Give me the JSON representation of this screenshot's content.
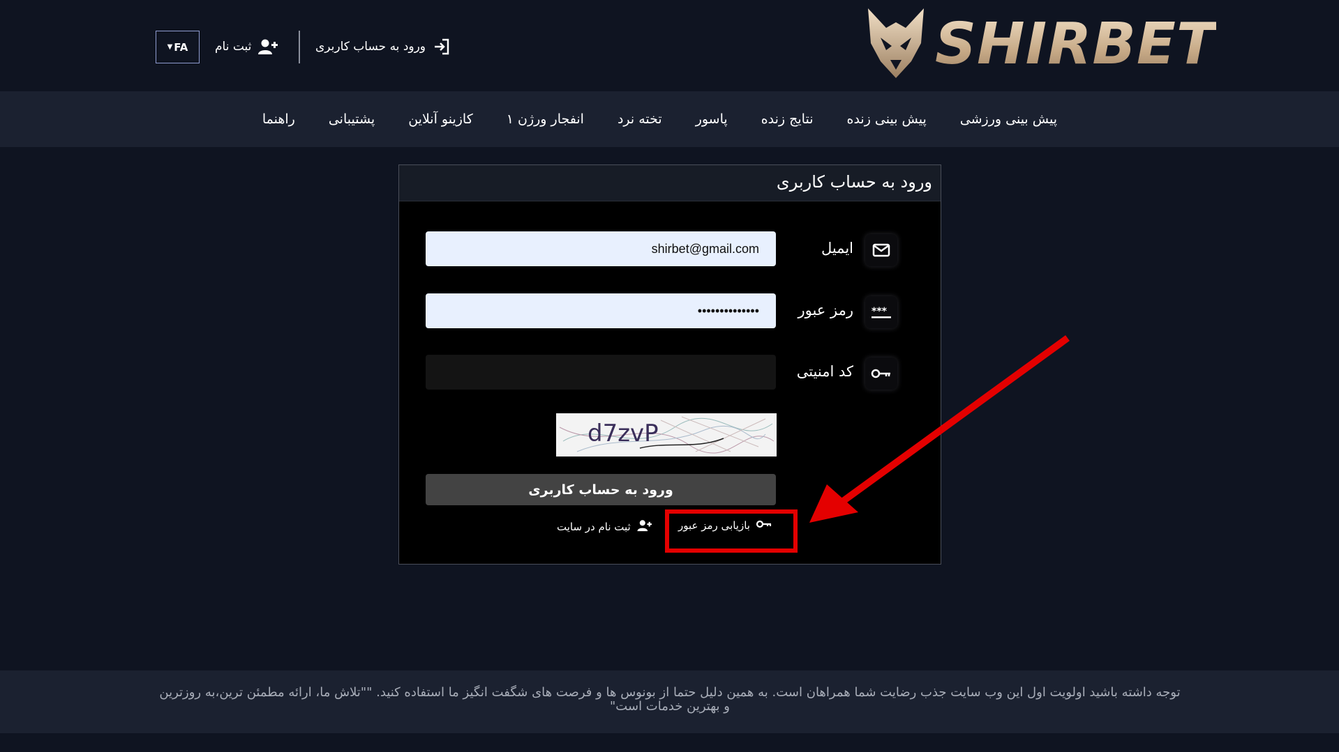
{
  "header": {
    "logo_text": "SHIRBET",
    "lang": "FA",
    "register_label": "ثبت نام",
    "login_label": "ورود به حساب کاربری"
  },
  "nav": {
    "items": [
      "پیش بینی ورزشی",
      "پیش بینی زنده",
      "نتایج زنده",
      "پاسور",
      "تخته نرد",
      "انفجار ورژن ۱",
      "کازینو آنلاین",
      "پشتیبانی",
      "راهنما"
    ]
  },
  "login_form": {
    "title": "ورود به حساب کاربری",
    "email_label": "ایمیل",
    "email_value": "shirbet@gmail.com",
    "password_label": "رمز عبور",
    "password_value": "••••••••••••••",
    "security_label": "کد امنیتی",
    "security_value": "",
    "captcha_text": "d7zvP",
    "submit_label": "ورود به حساب کاربری",
    "recover_label": "بازیابی رمز عبور",
    "signup_label": "ثبت نام در سایت"
  },
  "notice": {
    "text": "توجه داشته باشید اولویت اول این وب سایت جذب رضایت شما همراهان است. به همین دلیل حتما از بونوس ها و فرصت های شگفت انگیز ما استفاده کنید. \"\"تلاش ما، ارائه مطمئن ترین،به روزترین و بهترین خدمات است\""
  },
  "colors": {
    "background": "#0f1421",
    "nav_background": "#1b2130",
    "logo_gold": "#d8c1a3",
    "input_fill": "#e8f0fe",
    "button_fill": "#434343",
    "highlight_red": "#e40000"
  },
  "icons": {
    "register": "user-plus-icon",
    "login": "sign-in-icon",
    "email": "envelope-icon",
    "password": "asterisks-icon",
    "security": "key-icon",
    "recover": "key-icon",
    "signup": "user-plus-icon",
    "lang": "caret-down-icon"
  }
}
